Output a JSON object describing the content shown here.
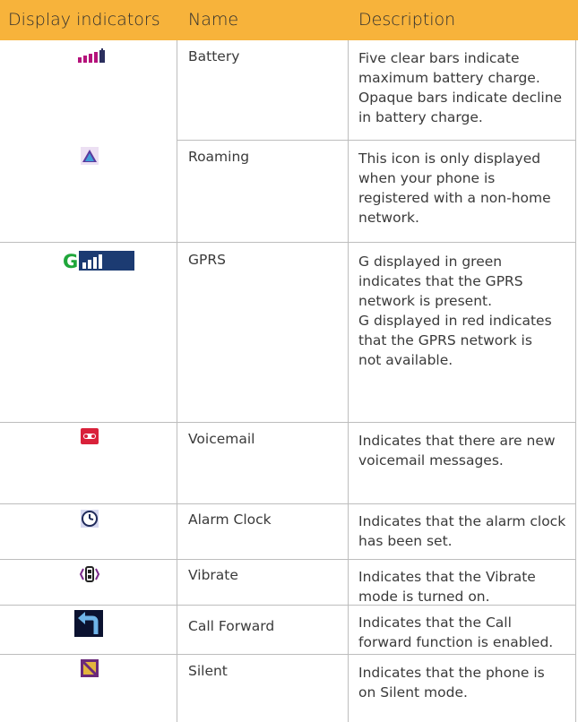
{
  "header": {
    "col1": "Display indicators",
    "col2": "Name",
    "col3": "Description"
  },
  "rows": [
    {
      "icon": "battery-icon",
      "name": "Battery",
      "desc": [
        "Five clear bars indicate",
        "maximum battery charge.",
        "Opaque bars indicate decline",
        "in battery charge."
      ]
    },
    {
      "icon": "roaming-icon",
      "name": "Roaming",
      "desc": [
        "This icon is only displayed",
        "when your phone is",
        "registered with a non-home",
        "network."
      ]
    },
    {
      "icon": "gprs-icon",
      "name": "GPRS",
      "desc": [
        "G displayed in green",
        "indicates that the GPRS",
        "network is present.",
        "G displayed in red indicates",
        "that the GPRS network is",
        "not available."
      ]
    },
    {
      "icon": "voicemail-icon",
      "name": "Voicemail",
      "desc": [
        "Indicates that there are new",
        "voicemail messages."
      ]
    },
    {
      "icon": "alarm-clock-icon",
      "name": "Alarm Clock",
      "desc": [
        "Indicates that the alarm clock",
        "has been set."
      ]
    },
    {
      "icon": "vibrate-icon",
      "name": "Vibrate",
      "desc": [
        "Indicates that the Vibrate",
        "mode is turned on."
      ]
    },
    {
      "icon": "call-forward-icon",
      "name": "Call Forward",
      "desc": [
        "Indicates that the Call",
        "forward function is enabled."
      ]
    },
    {
      "icon": "silent-icon",
      "name": "Silent",
      "desc": [
        "Indicates that the phone is",
        "on Silent mode."
      ]
    }
  ]
}
